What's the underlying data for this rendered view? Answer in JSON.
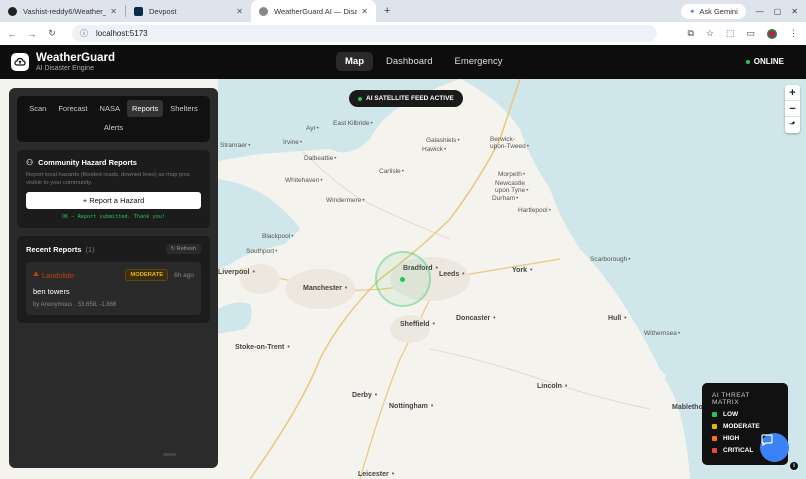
{
  "browser": {
    "tabs": [
      {
        "title": "Vashist-reddy6/Weather_Proje...",
        "active": false
      },
      {
        "title": "Devpost",
        "active": false
      },
      {
        "title": "WeatherGuard AI — Disaster Pr...",
        "active": true
      }
    ],
    "gemini_label": "Ask Gemini",
    "url": "localhost:5173"
  },
  "app": {
    "name": "WeatherGuard",
    "subtitle": "AI Disaster Engine",
    "nav": [
      "Map",
      "Dashboard",
      "Emergency"
    ],
    "active_nav": "Map",
    "status": "ONLINE"
  },
  "map": {
    "feed_label": "AI SATELLITE FEED ACTIVE",
    "zoom_in": "+",
    "zoom_out": "−",
    "cities": [
      {
        "name": "Ayr"
      },
      {
        "name": "East Kilbride"
      },
      {
        "name": "Irvine"
      },
      {
        "name": "Galashiels"
      },
      {
        "name": "Berwick-upon-Tweed"
      },
      {
        "name": "Hawick"
      },
      {
        "name": "Stranraer"
      },
      {
        "name": "Dalbeattie"
      },
      {
        "name": "Carlisle"
      },
      {
        "name": "Whitehaven"
      },
      {
        "name": "Morpeth"
      },
      {
        "name": "Newcastle upon Tyne"
      },
      {
        "name": "Durham"
      },
      {
        "name": "Windermere"
      },
      {
        "name": "Hartlepool"
      },
      {
        "name": "Blackpool"
      },
      {
        "name": "Southport"
      },
      {
        "name": "Bradford"
      },
      {
        "name": "Leeds"
      },
      {
        "name": "York"
      },
      {
        "name": "Scarborough"
      },
      {
        "name": "Liverpool"
      },
      {
        "name": "Manchester"
      },
      {
        "name": "Sheffield"
      },
      {
        "name": "Doncaster"
      },
      {
        "name": "Hull"
      },
      {
        "name": "Withernsea"
      },
      {
        "name": "Stoke-on-Trent"
      },
      {
        "name": "Lincoln"
      },
      {
        "name": "Derby"
      },
      {
        "name": "Nottingham"
      },
      {
        "name": "Mablethorpe"
      },
      {
        "name": "Leicester"
      }
    ]
  },
  "panel": {
    "tabs": [
      "Scan",
      "Forecast",
      "NASA",
      "Reports",
      "Shelters",
      "Alerts"
    ],
    "active_tab": "Reports",
    "community": {
      "title": "Community Hazard Reports",
      "description": "Report local hazards (flooded roads, downed lines) as map pins visible to your community.",
      "button": "+ Report a Hazard",
      "confirmation": "OK — Report submitted. Thank you!"
    },
    "recent": {
      "title": "Recent Reports",
      "count": "(1)",
      "refresh": "↻ Refresh",
      "items": [
        {
          "type": "Landslide",
          "severity": "MODERATE",
          "ago": "6h ago",
          "description": "ben towers",
          "meta": "by Anonymous · 53.658, -1.868"
        }
      ]
    }
  },
  "matrix": {
    "title": "AI THREAT MATRIX",
    "levels": [
      {
        "label": "LOW",
        "color": "#22c55e"
      },
      {
        "label": "MODERATE",
        "color": "#eab308"
      },
      {
        "label": "HIGH",
        "color": "#f97316"
      },
      {
        "label": "CRITICAL",
        "color": "#ef4444"
      }
    ]
  },
  "colors": {
    "accent": "#22c55e",
    "chat": "#3b82f6",
    "header": "#0d0d0d"
  }
}
